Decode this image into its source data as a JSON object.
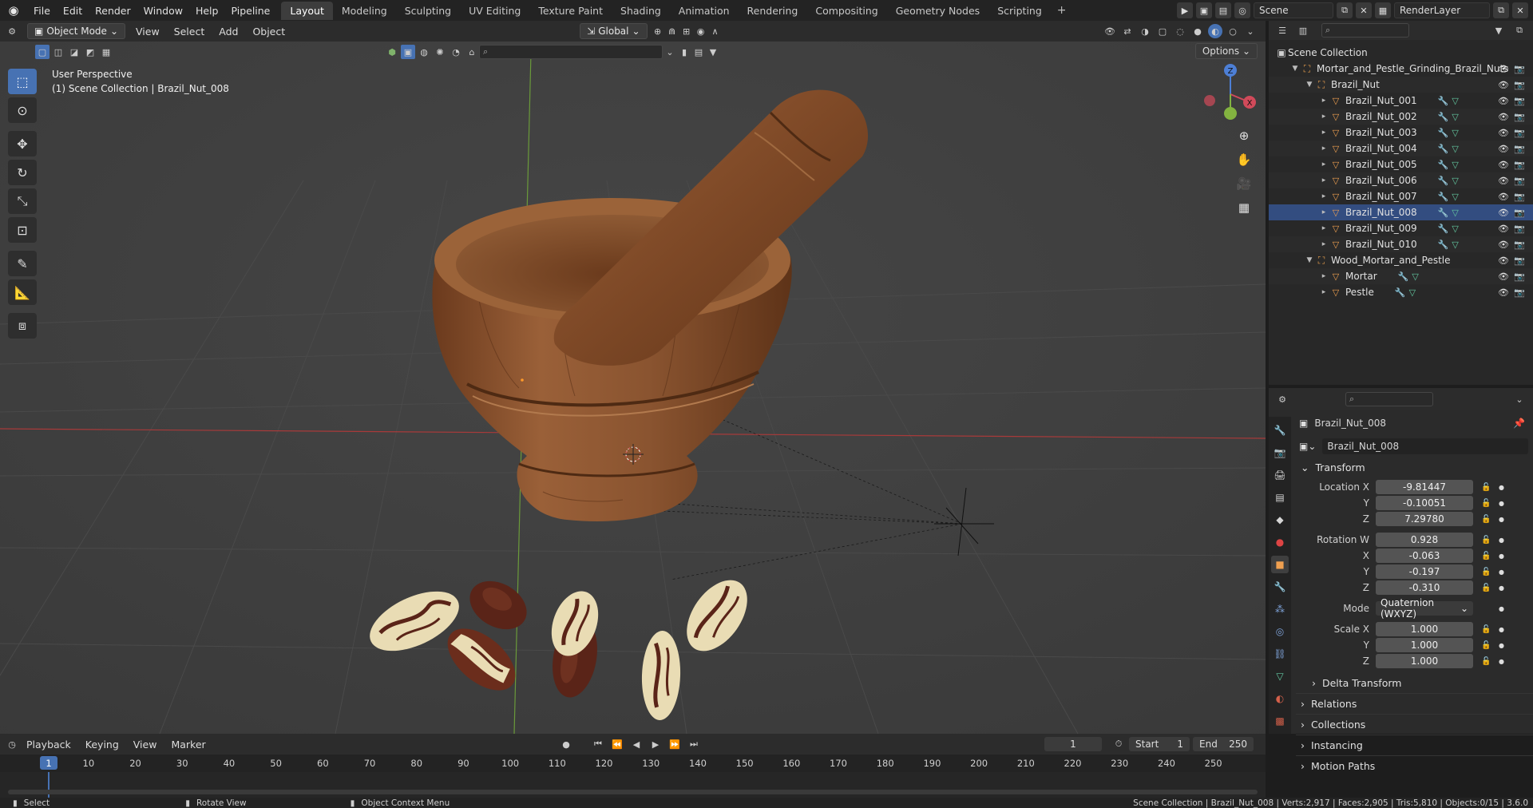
{
  "app": {
    "menus": [
      "File",
      "Edit",
      "Render",
      "Window",
      "Help",
      "Pipeline"
    ]
  },
  "workspaces": [
    "Layout",
    "Modeling",
    "Sculpting",
    "UV Editing",
    "Texture Paint",
    "Shading",
    "Animation",
    "Rendering",
    "Compositing",
    "Geometry Nodes",
    "Scripting"
  ],
  "active_workspace": "Layout",
  "top_right": {
    "scene": "Scene",
    "view_layer": "RenderLayer"
  },
  "viewport": {
    "mode": "Object Mode",
    "menus": [
      "View",
      "Select",
      "Add",
      "Object"
    ],
    "transform_orientation": "Global",
    "options_label": "Options",
    "perspective_label": "User Perspective",
    "context_label": "(1) Scene Collection | Brazil_Nut_008",
    "gizmo_axes": {
      "z": "Z",
      "x": "X",
      "y": "Y"
    }
  },
  "outliner": {
    "root": "Scene Collection",
    "rows": [
      {
        "name": "Mortar_and_Pestle_Grinding_Brazil_Nuts",
        "type": "collection",
        "indent": 1
      },
      {
        "name": "Brazil_Nut",
        "type": "collection",
        "indent": 2
      },
      {
        "name": "Brazil_Nut_001",
        "type": "mesh",
        "indent": 3
      },
      {
        "name": "Brazil_Nut_002",
        "type": "mesh",
        "indent": 3
      },
      {
        "name": "Brazil_Nut_003",
        "type": "mesh",
        "indent": 3
      },
      {
        "name": "Brazil_Nut_004",
        "type": "mesh",
        "indent": 3
      },
      {
        "name": "Brazil_Nut_005",
        "type": "mesh",
        "indent": 3
      },
      {
        "name": "Brazil_Nut_006",
        "type": "mesh",
        "indent": 3
      },
      {
        "name": "Brazil_Nut_007",
        "type": "mesh",
        "indent": 3
      },
      {
        "name": "Brazil_Nut_008",
        "type": "mesh",
        "indent": 3
      },
      {
        "name": "Brazil_Nut_009",
        "type": "mesh",
        "indent": 3
      },
      {
        "name": "Brazil_Nut_010",
        "type": "mesh",
        "indent": 3
      },
      {
        "name": "Wood_Mortar_and_Pestle",
        "type": "collection",
        "indent": 2
      },
      {
        "name": "Mortar",
        "type": "mesh",
        "indent": 3
      },
      {
        "name": "Pestle",
        "type": "mesh",
        "indent": 3
      }
    ]
  },
  "properties": {
    "object_name": "Brazil_Nut_008",
    "datablock": "Brazil_Nut_008",
    "transform_title": "Transform",
    "location": {
      "label_x": "Location X",
      "x": "-9.81447",
      "y": "-0.10051",
      "z": "7.29780"
    },
    "rotation": {
      "label_w": "Rotation W",
      "w": "0.928",
      "x": "-0.063",
      "y": "-0.197",
      "z": "-0.310"
    },
    "mode_label": "Mode",
    "mode_value": "Quaternion (WXYZ)",
    "scale": {
      "label_x": "Scale X",
      "x": "1.000",
      "y": "1.000",
      "z": "1.000"
    },
    "axis": {
      "y": "Y",
      "z": "Z",
      "x": "X"
    },
    "sections": [
      "Delta Transform",
      "Relations",
      "Collections",
      "Instancing",
      "Motion Paths"
    ]
  },
  "timeline": {
    "menus": [
      "Playback",
      "Keying",
      "View",
      "Marker"
    ],
    "current_frame": "1",
    "start_label": "Start",
    "start": "1",
    "end_label": "End",
    "end": "250",
    "ticks": [
      "1",
      "10",
      "20",
      "30",
      "40",
      "50",
      "60",
      "70",
      "80",
      "90",
      "100",
      "110",
      "120",
      "130",
      "140",
      "150",
      "160",
      "170",
      "180",
      "190",
      "200",
      "210",
      "220",
      "230",
      "240",
      "250"
    ]
  },
  "statusbar": {
    "select": "Select",
    "rotate": "Rotate View",
    "context": "Object Context Menu",
    "stats": "Scene Collection | Brazil_Nut_008 | Verts:2,917 | Faces:2,905 | Tris:5,810 | Objects:0/15 | 3.6.0"
  },
  "colors": {
    "accent": "#4772b3",
    "wood": "#8a5430",
    "nut_shell": "#5a2418",
    "nut_kernel": "#e9dcb4"
  }
}
